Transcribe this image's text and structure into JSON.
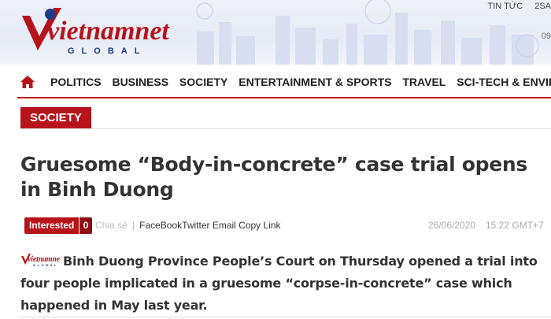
{
  "header": {
    "logo_text": "vietnamnet",
    "logo_sub": "GLOBAL",
    "top_links": [
      "TIN TỨC",
      "2SA"
    ],
    "date_fragment": "09"
  },
  "nav": {
    "items": [
      "POLITICS",
      "BUSINESS",
      "SOCIETY",
      "ENTERTAINMENT & SPORTS",
      "TRAVEL",
      "SCI-TECH & ENVIRONME"
    ]
  },
  "category": "SOCIETY",
  "article": {
    "title": "Gruesome “Body-in-concrete” case trial opens in Binh Duong",
    "interested_label": "Interested",
    "interested_count": "0",
    "share_label": "Chia sẻ",
    "share_links": "FaceBookTwitter Email Copy Link",
    "date": "26/06/2020",
    "time": "15:22 GMT+7",
    "lead": "Binh Duong Province People’s Court on Thursday opened a trial into four people implicated in a gruesome “corpse-in-concrete” case which happened in May last year."
  },
  "colors": {
    "brand_red": "#b7131a",
    "brand_blue": "#1e3a8c"
  },
  "icons": [
    "home-icon",
    "vietnamnet-logo"
  ]
}
